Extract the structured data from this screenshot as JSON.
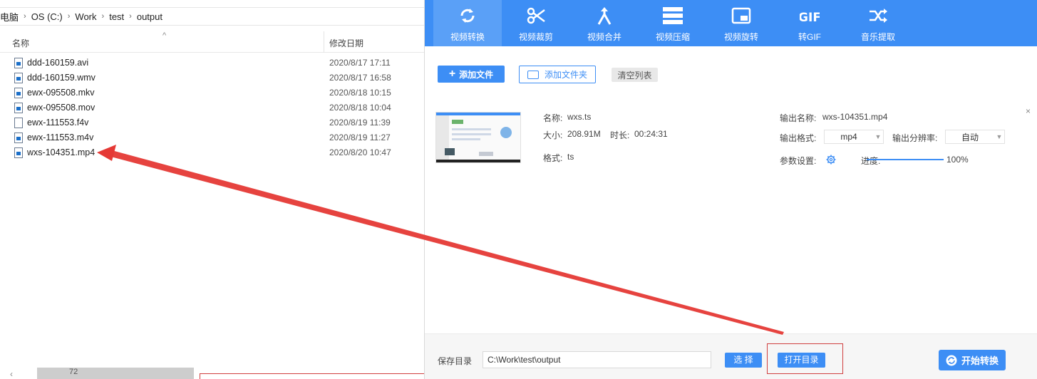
{
  "explorer": {
    "breadcrumbs": [
      "电脑",
      "OS (C:)",
      "Work",
      "test",
      "output"
    ],
    "columns": {
      "name": "名称",
      "date": "修改日期"
    },
    "files": [
      {
        "name": "ddd-160159.avi",
        "date": "2020/8/17 17:11",
        "icon": "video-file-icon"
      },
      {
        "name": "ddd-160159.wmv",
        "date": "2020/8/17 16:58",
        "icon": "video-file-icon"
      },
      {
        "name": "ewx-095508.mkv",
        "date": "2020/8/18 10:15",
        "icon": "video-file-icon"
      },
      {
        "name": "ewx-095508.mov",
        "date": "2020/8/18 10:04",
        "icon": "video-file-icon"
      },
      {
        "name": "ewx-111553.f4v",
        "date": "2020/8/19 11:39",
        "icon": "file-icon"
      },
      {
        "name": "ewx-111553.m4v",
        "date": "2020/8/19 11:27",
        "icon": "video-file-icon"
      },
      {
        "name": "wxs-104351.mp4",
        "date": "2020/8/20 10:47",
        "icon": "video-file-icon"
      }
    ],
    "footer_value": "72"
  },
  "app": {
    "nav": [
      {
        "label": "视频转换",
        "icon": "convert-icon",
        "active": true
      },
      {
        "label": "视频裁剪",
        "icon": "scissors-icon",
        "active": false
      },
      {
        "label": "视频合并",
        "icon": "merge-icon",
        "active": false
      },
      {
        "label": "视频压缩",
        "icon": "compress-icon",
        "active": false
      },
      {
        "label": "视频旋转",
        "icon": "rotate-icon",
        "active": false
      },
      {
        "label": "转GIF",
        "icon": "gif-icon",
        "active": false
      },
      {
        "label": "音乐提取",
        "icon": "shuffle-icon",
        "active": false
      }
    ],
    "toolbar": {
      "add_file": "添加文件",
      "add_folder": "添加文件夹",
      "clear_list": "清空列表"
    },
    "item": {
      "name_label": "名称:",
      "name_value": "wxs.ts",
      "size_label": "大小:",
      "size_value": "208.91M",
      "duration_label": "时长:",
      "duration_value": "00:24:31",
      "format_label": "格式:",
      "format_value": "ts",
      "output_name_label": "输出名称:",
      "output_name_value": "wxs-104351.mp4",
      "output_format_label": "输出格式:",
      "output_format_value": "mp4",
      "output_res_label": "输出分辨率:",
      "output_res_value": "自动",
      "params_label": "参数设置:",
      "progress_label": "进度:",
      "progress_value": "100%",
      "progress_fraction": 1.0,
      "close": "×"
    },
    "footer": {
      "save_dir_label": "保存目录",
      "save_dir_value": "C:\\Work\\test\\output",
      "choose": "选 择",
      "open_dir": "打开目录",
      "start": "开始转换"
    },
    "colors": {
      "accent": "#3d8ef5",
      "annotation": "#e53935"
    }
  }
}
